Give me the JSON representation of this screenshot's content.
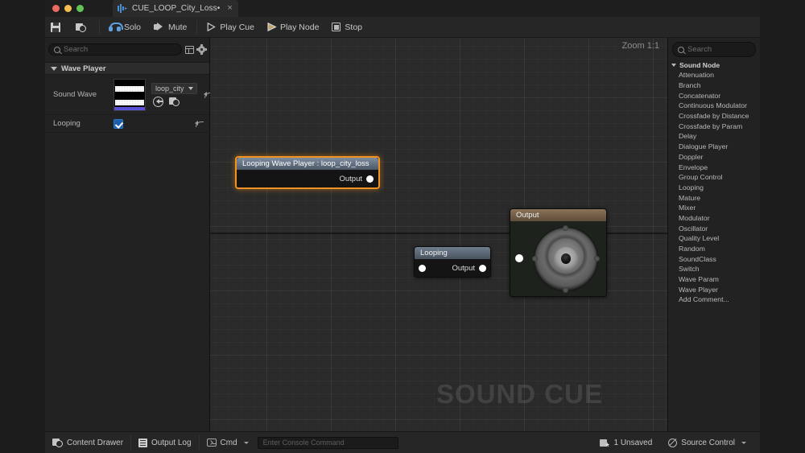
{
  "window": {
    "tab_title": "CUE_LOOP_City_Loss•",
    "tab_close": "×",
    "app_icon": "audio-waveform-icon"
  },
  "toolbar": {
    "save_label": "",
    "browse_label": "",
    "solo_label": "Solo",
    "mute_label": "Mute",
    "play_cue_label": "Play Cue",
    "play_node_label": "Play Node",
    "stop_label": "Stop"
  },
  "details": {
    "search_placeholder": "Search",
    "category": "Wave Player",
    "rows": [
      {
        "label": "Sound Wave",
        "value": "loop_city"
      },
      {
        "label": "Looping",
        "value": ""
      }
    ]
  },
  "graph": {
    "zoom_label": "Zoom 1:1",
    "watermark": "SOUND CUE",
    "nodes": [
      {
        "title": "Looping Wave Player : loop_city_loss",
        "output_label": "Output",
        "selected": true,
        "accent": "#f2921f"
      },
      {
        "title": "Looping",
        "output_label": "Output",
        "selected": false
      },
      {
        "title": "Output",
        "output_label": "",
        "selected": false
      }
    ]
  },
  "palette": {
    "search_placeholder": "Search",
    "category": "Sound Node",
    "items": [
      "Attenuation",
      "Branch",
      "Concatenator",
      "Continuous Modulator",
      "Crossfade by Distance",
      "Crossfade by Param",
      "Delay",
      "Dialogue Player",
      "Doppler",
      "Envelope",
      "Group Control",
      "Looping",
      "Mature",
      "Mixer",
      "Modulator",
      "Oscillator",
      "Quality Level",
      "Random",
      "SoundClass",
      "Switch",
      "Wave Param",
      "Wave Player",
      "Add Comment..."
    ]
  },
  "statusbar": {
    "content_drawer": "Content Drawer",
    "output_log": "Output Log",
    "cmd": "Cmd",
    "console_placeholder": "Enter Console Command",
    "unsaved": "1 Unsaved",
    "source_control": "Source Control"
  }
}
